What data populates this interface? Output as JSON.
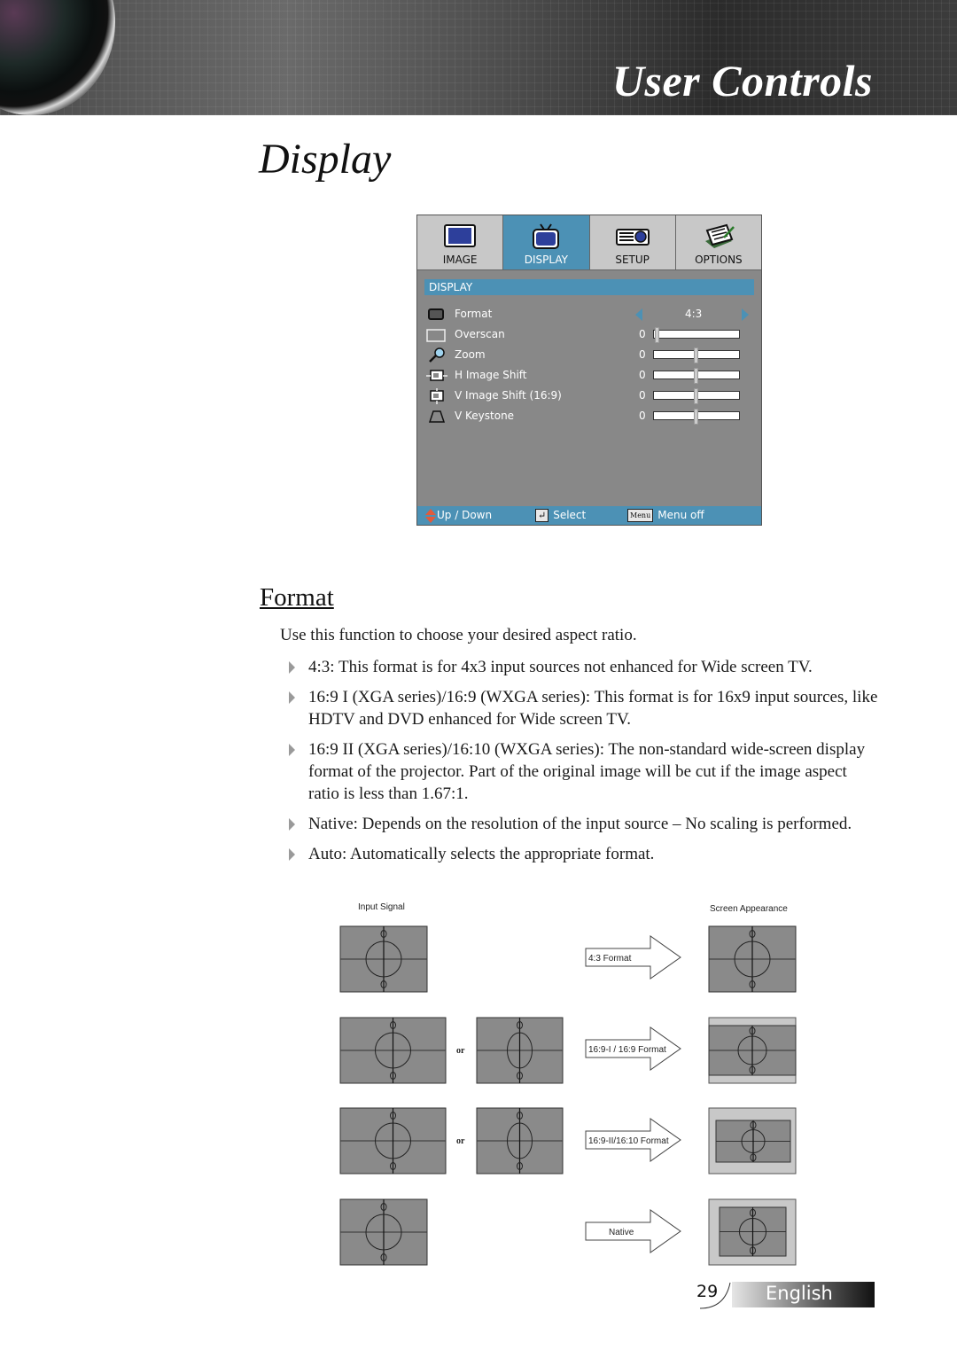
{
  "header": {
    "banner_title": "User Controls",
    "page_title": "Display"
  },
  "osd": {
    "tabs": [
      {
        "label": "IMAGE",
        "icon": "monitor-icon",
        "active": false
      },
      {
        "label": "DISPLAY",
        "icon": "tv-icon",
        "active": true
      },
      {
        "label": "SETUP",
        "icon": "projector-icon",
        "active": false
      },
      {
        "label": "OPTIONS",
        "icon": "notepad-icon",
        "active": false
      }
    ],
    "section": "DISPLAY",
    "rows": [
      {
        "label": "Format",
        "icon": "format-icon",
        "type": "selector",
        "value": "4:3"
      },
      {
        "label": "Overscan",
        "icon": "overscan-icon",
        "type": "slider",
        "value": "0",
        "position": 0.0
      },
      {
        "label": "Zoom",
        "icon": "magnifier-icon",
        "type": "slider",
        "value": "0",
        "position": 0.5
      },
      {
        "label": "H Image Shift",
        "icon": "h-shift-icon",
        "type": "slider",
        "value": "0",
        "position": 0.5
      },
      {
        "label": "V Image Shift (16:9)",
        "icon": "v-shift-icon",
        "type": "slider",
        "value": "0",
        "position": 0.5
      },
      {
        "label": "V Keystone",
        "icon": "keystone-icon",
        "type": "slider",
        "value": "0",
        "position": 0.5
      }
    ],
    "footer": {
      "updown": "Up / Down",
      "select": "Select",
      "menu_key": "Menu",
      "menu_off": "Menu off"
    },
    "accent_color": "#4c91b5"
  },
  "content": {
    "section_title": "Format",
    "intro": "Use this function to choose your desired aspect ratio.",
    "bullets": [
      "4:3: This format is for 4x3 input sources not enhanced for Wide screen TV.",
      "16:9 I (XGA series)/16:9 (WXGA series): This format is for 16x9 input sources, like HDTV and DVD enhanced for Wide screen TV.",
      "16:9 II (XGA series)/16:10 (WXGA series): The non-standard wide-screen display format of the projector. Part of the original image will be cut if the image aspect ratio is less than 1.67:1.",
      "Native: Depends on the resolution of the input source – No scaling is performed.",
      "Auto: Automatically selects the appropriate format."
    ]
  },
  "diagram": {
    "input_label": "Input Signal",
    "output_label": "Screen Appearance",
    "or_label": "or",
    "rows": [
      {
        "arrow": "4:3 Format"
      },
      {
        "arrow": "16:9-I / 16:9  Format"
      },
      {
        "arrow": "16:9-II/16:10 Format"
      },
      {
        "arrow": "Native"
      }
    ]
  },
  "footer": {
    "page_number": "29",
    "language": "English"
  }
}
